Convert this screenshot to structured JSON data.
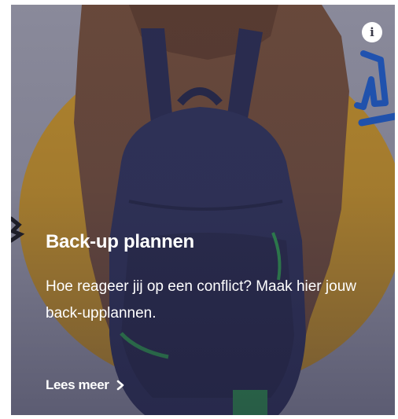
{
  "card": {
    "title": "Back-up plannen",
    "description": "Hoe reageer jij op een conflict? Maak hier jouw back-upplannen.",
    "link_label": "Lees meer",
    "info_glyph": "i"
  },
  "icons": {
    "info": "info-icon",
    "link": "chevron-right-icon"
  },
  "colors": {
    "card_background": "#8f8f9f",
    "blob": "#b8892a",
    "jacket": "#6b4a3a",
    "backpack": "#2f3258",
    "scribble": "#1f56b8",
    "text": "#ffffff"
  }
}
